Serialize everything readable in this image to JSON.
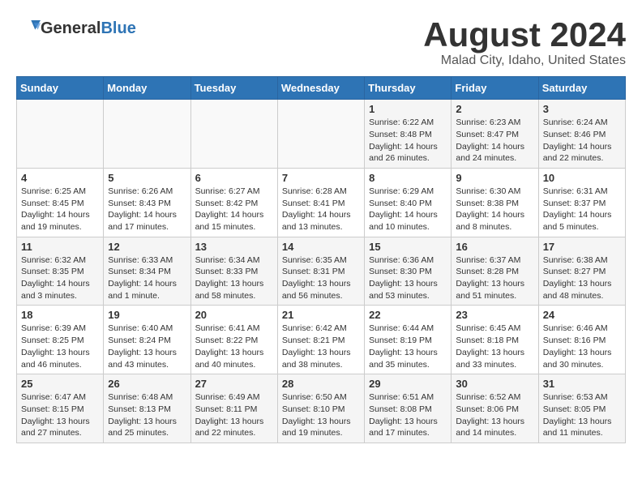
{
  "header": {
    "logo_general": "General",
    "logo_blue": "Blue",
    "month": "August 2024",
    "location": "Malad City, Idaho, United States"
  },
  "weekdays": [
    "Sunday",
    "Monday",
    "Tuesday",
    "Wednesday",
    "Thursday",
    "Friday",
    "Saturday"
  ],
  "weeks": [
    [
      {
        "day": "",
        "sunrise": "",
        "sunset": "",
        "daylight": ""
      },
      {
        "day": "",
        "sunrise": "",
        "sunset": "",
        "daylight": ""
      },
      {
        "day": "",
        "sunrise": "",
        "sunset": "",
        "daylight": ""
      },
      {
        "day": "",
        "sunrise": "",
        "sunset": "",
        "daylight": ""
      },
      {
        "day": "1",
        "sunrise": "Sunrise: 6:22 AM",
        "sunset": "Sunset: 8:48 PM",
        "daylight": "Daylight: 14 hours and 26 minutes."
      },
      {
        "day": "2",
        "sunrise": "Sunrise: 6:23 AM",
        "sunset": "Sunset: 8:47 PM",
        "daylight": "Daylight: 14 hours and 24 minutes."
      },
      {
        "day": "3",
        "sunrise": "Sunrise: 6:24 AM",
        "sunset": "Sunset: 8:46 PM",
        "daylight": "Daylight: 14 hours and 22 minutes."
      }
    ],
    [
      {
        "day": "4",
        "sunrise": "Sunrise: 6:25 AM",
        "sunset": "Sunset: 8:45 PM",
        "daylight": "Daylight: 14 hours and 19 minutes."
      },
      {
        "day": "5",
        "sunrise": "Sunrise: 6:26 AM",
        "sunset": "Sunset: 8:43 PM",
        "daylight": "Daylight: 14 hours and 17 minutes."
      },
      {
        "day": "6",
        "sunrise": "Sunrise: 6:27 AM",
        "sunset": "Sunset: 8:42 PM",
        "daylight": "Daylight: 14 hours and 15 minutes."
      },
      {
        "day": "7",
        "sunrise": "Sunrise: 6:28 AM",
        "sunset": "Sunset: 8:41 PM",
        "daylight": "Daylight: 14 hours and 13 minutes."
      },
      {
        "day": "8",
        "sunrise": "Sunrise: 6:29 AM",
        "sunset": "Sunset: 8:40 PM",
        "daylight": "Daylight: 14 hours and 10 minutes."
      },
      {
        "day": "9",
        "sunrise": "Sunrise: 6:30 AM",
        "sunset": "Sunset: 8:38 PM",
        "daylight": "Daylight: 14 hours and 8 minutes."
      },
      {
        "day": "10",
        "sunrise": "Sunrise: 6:31 AM",
        "sunset": "Sunset: 8:37 PM",
        "daylight": "Daylight: 14 hours and 5 minutes."
      }
    ],
    [
      {
        "day": "11",
        "sunrise": "Sunrise: 6:32 AM",
        "sunset": "Sunset: 8:35 PM",
        "daylight": "Daylight: 14 hours and 3 minutes."
      },
      {
        "day": "12",
        "sunrise": "Sunrise: 6:33 AM",
        "sunset": "Sunset: 8:34 PM",
        "daylight": "Daylight: 14 hours and 1 minute."
      },
      {
        "day": "13",
        "sunrise": "Sunrise: 6:34 AM",
        "sunset": "Sunset: 8:33 PM",
        "daylight": "Daylight: 13 hours and 58 minutes."
      },
      {
        "day": "14",
        "sunrise": "Sunrise: 6:35 AM",
        "sunset": "Sunset: 8:31 PM",
        "daylight": "Daylight: 13 hours and 56 minutes."
      },
      {
        "day": "15",
        "sunrise": "Sunrise: 6:36 AM",
        "sunset": "Sunset: 8:30 PM",
        "daylight": "Daylight: 13 hours and 53 minutes."
      },
      {
        "day": "16",
        "sunrise": "Sunrise: 6:37 AM",
        "sunset": "Sunset: 8:28 PM",
        "daylight": "Daylight: 13 hours and 51 minutes."
      },
      {
        "day": "17",
        "sunrise": "Sunrise: 6:38 AM",
        "sunset": "Sunset: 8:27 PM",
        "daylight": "Daylight: 13 hours and 48 minutes."
      }
    ],
    [
      {
        "day": "18",
        "sunrise": "Sunrise: 6:39 AM",
        "sunset": "Sunset: 8:25 PM",
        "daylight": "Daylight: 13 hours and 46 minutes."
      },
      {
        "day": "19",
        "sunrise": "Sunrise: 6:40 AM",
        "sunset": "Sunset: 8:24 PM",
        "daylight": "Daylight: 13 hours and 43 minutes."
      },
      {
        "day": "20",
        "sunrise": "Sunrise: 6:41 AM",
        "sunset": "Sunset: 8:22 PM",
        "daylight": "Daylight: 13 hours and 40 minutes."
      },
      {
        "day": "21",
        "sunrise": "Sunrise: 6:42 AM",
        "sunset": "Sunset: 8:21 PM",
        "daylight": "Daylight: 13 hours and 38 minutes."
      },
      {
        "day": "22",
        "sunrise": "Sunrise: 6:44 AM",
        "sunset": "Sunset: 8:19 PM",
        "daylight": "Daylight: 13 hours and 35 minutes."
      },
      {
        "day": "23",
        "sunrise": "Sunrise: 6:45 AM",
        "sunset": "Sunset: 8:18 PM",
        "daylight": "Daylight: 13 hours and 33 minutes."
      },
      {
        "day": "24",
        "sunrise": "Sunrise: 6:46 AM",
        "sunset": "Sunset: 8:16 PM",
        "daylight": "Daylight: 13 hours and 30 minutes."
      }
    ],
    [
      {
        "day": "25",
        "sunrise": "Sunrise: 6:47 AM",
        "sunset": "Sunset: 8:15 PM",
        "daylight": "Daylight: 13 hours and 27 minutes."
      },
      {
        "day": "26",
        "sunrise": "Sunrise: 6:48 AM",
        "sunset": "Sunset: 8:13 PM",
        "daylight": "Daylight: 13 hours and 25 minutes."
      },
      {
        "day": "27",
        "sunrise": "Sunrise: 6:49 AM",
        "sunset": "Sunset: 8:11 PM",
        "daylight": "Daylight: 13 hours and 22 minutes."
      },
      {
        "day": "28",
        "sunrise": "Sunrise: 6:50 AM",
        "sunset": "Sunset: 8:10 PM",
        "daylight": "Daylight: 13 hours and 19 minutes."
      },
      {
        "day": "29",
        "sunrise": "Sunrise: 6:51 AM",
        "sunset": "Sunset: 8:08 PM",
        "daylight": "Daylight: 13 hours and 17 minutes."
      },
      {
        "day": "30",
        "sunrise": "Sunrise: 6:52 AM",
        "sunset": "Sunset: 8:06 PM",
        "daylight": "Daylight: 13 hours and 14 minutes."
      },
      {
        "day": "31",
        "sunrise": "Sunrise: 6:53 AM",
        "sunset": "Sunset: 8:05 PM",
        "daylight": "Daylight: 13 hours and 11 minutes."
      }
    ]
  ]
}
